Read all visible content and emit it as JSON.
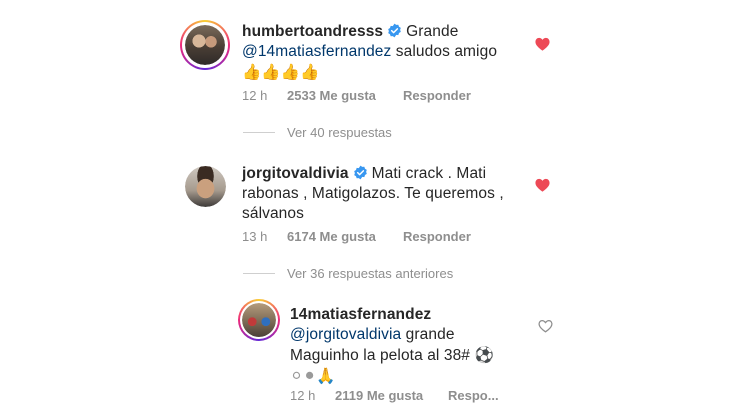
{
  "comments": [
    {
      "username": "humbertoandresss",
      "text_1": "Grande",
      "mention": "@14matiasfernandez",
      "text_2": "saludos amigo",
      "emojis": "👍👍👍👍",
      "time": "12 h",
      "likes": "2533 Me gusta",
      "reply": "Responder"
    },
    {
      "username": "jorgitovaldivia",
      "text_1": "Mati crack . Mati",
      "text_2": "rabonas , Matigolazos. Te queremos ,",
      "text_3": "sálvanos",
      "time": "13 h",
      "likes": "6174 Me gusta",
      "reply": "Responder"
    }
  ],
  "view_replies_1": "Ver 40 respuestas",
  "view_replies_2": "Ver 36 respuestas anteriores",
  "reply": {
    "username": "14matiasfernandez",
    "mention": "@jorgitovaldivia",
    "text_1": "grande",
    "text_2": "Maguinho la pelota al 38#",
    "ball_emoji": "⚽",
    "emojis": "⚪⚫🙏",
    "time": "12 h",
    "likes": "2119 Me gusta",
    "reply": "Respo..."
  },
  "colors": {
    "text": "#262626",
    "muted": "#8e8e8e",
    "mention": "#00376b",
    "heart_red": "#ed4956",
    "verified_blue": "#3897f0"
  }
}
